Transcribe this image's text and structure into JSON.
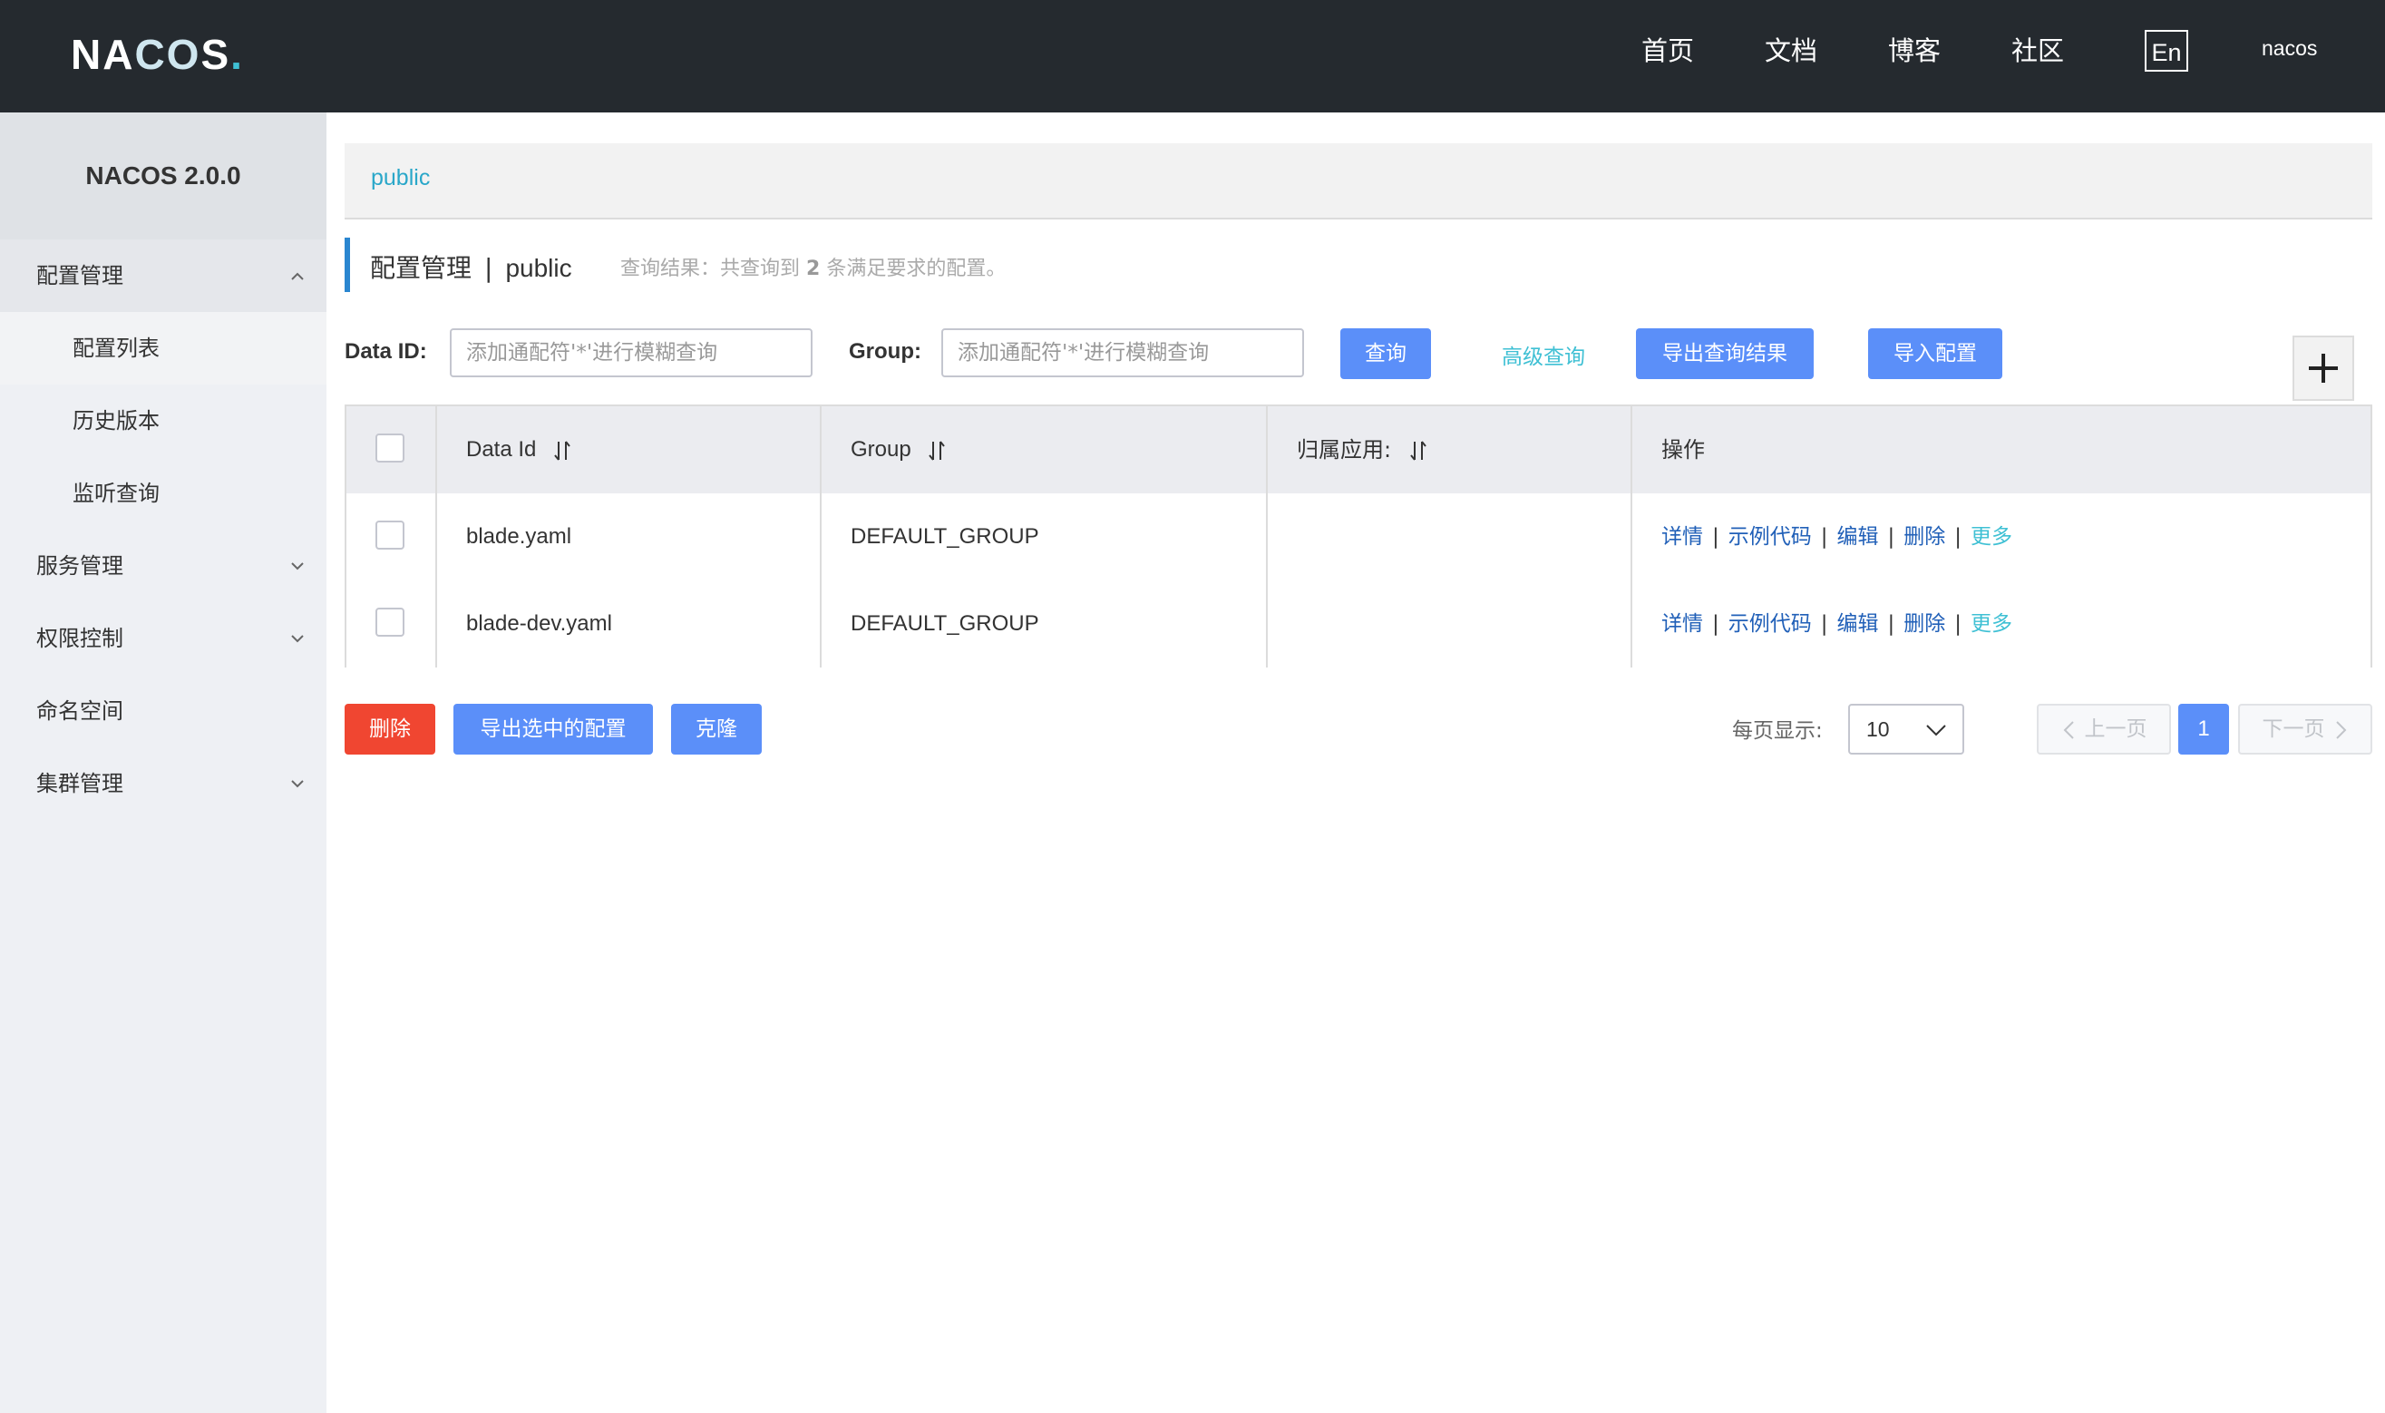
{
  "header": {
    "logo": "NACOS.",
    "nav": [
      "首页",
      "文档",
      "博客",
      "社区"
    ],
    "lang": "En",
    "user": "nacos"
  },
  "sidebar": {
    "title": "NACOS 2.0.0",
    "items": [
      {
        "label": "配置管理",
        "level": 1,
        "expanded": true
      },
      {
        "label": "配置列表",
        "level": 2,
        "selected": true
      },
      {
        "label": "历史版本",
        "level": 2
      },
      {
        "label": "监听查询",
        "level": 2
      },
      {
        "label": "服务管理",
        "level": 1,
        "expanded": false
      },
      {
        "label": "权限控制",
        "level": 1,
        "expanded": false
      },
      {
        "label": "命名空间",
        "level": 1
      },
      {
        "label": "集群管理",
        "level": 1,
        "expanded": false
      }
    ]
  },
  "namespace_tab": "public",
  "page": {
    "title": "配置管理",
    "namespace": "public",
    "result_prefix": "查询结果：共查询到",
    "result_count": "2",
    "result_suffix": "条满足要求的配置。"
  },
  "search": {
    "data_id_label": "Data ID:",
    "data_id_placeholder": "添加通配符'*'进行模糊查询",
    "group_label": "Group:",
    "group_placeholder": "添加通配符'*'进行模糊查询",
    "query_button": "查询",
    "advanced_query": "高级查询",
    "export_results_button": "导出查询结果",
    "import_button": "导入配置"
  },
  "table": {
    "columns": [
      "Data Id",
      "Group",
      "归属应用:",
      "操作"
    ],
    "rows": [
      {
        "data_id": "blade.yaml",
        "group": "DEFAULT_GROUP",
        "app": ""
      },
      {
        "data_id": "blade-dev.yaml",
        "group": "DEFAULT_GROUP",
        "app": ""
      }
    ],
    "actions": [
      "详情",
      "示例代码",
      "编辑",
      "删除",
      "更多"
    ]
  },
  "bottom": {
    "delete_button": "删除",
    "export_selected_button": "导出选中的配置",
    "clone_button": "克隆",
    "page_size_label": "每页显示:",
    "page_size": "10",
    "prev": "上一页",
    "current_page": "1",
    "next": "下一页"
  },
  "colors": {
    "header_bg": "#252a2f",
    "primary": "#5b8ff9",
    "danger": "#f04631",
    "link": "#2160b8",
    "accent": "#3fc0d4"
  }
}
